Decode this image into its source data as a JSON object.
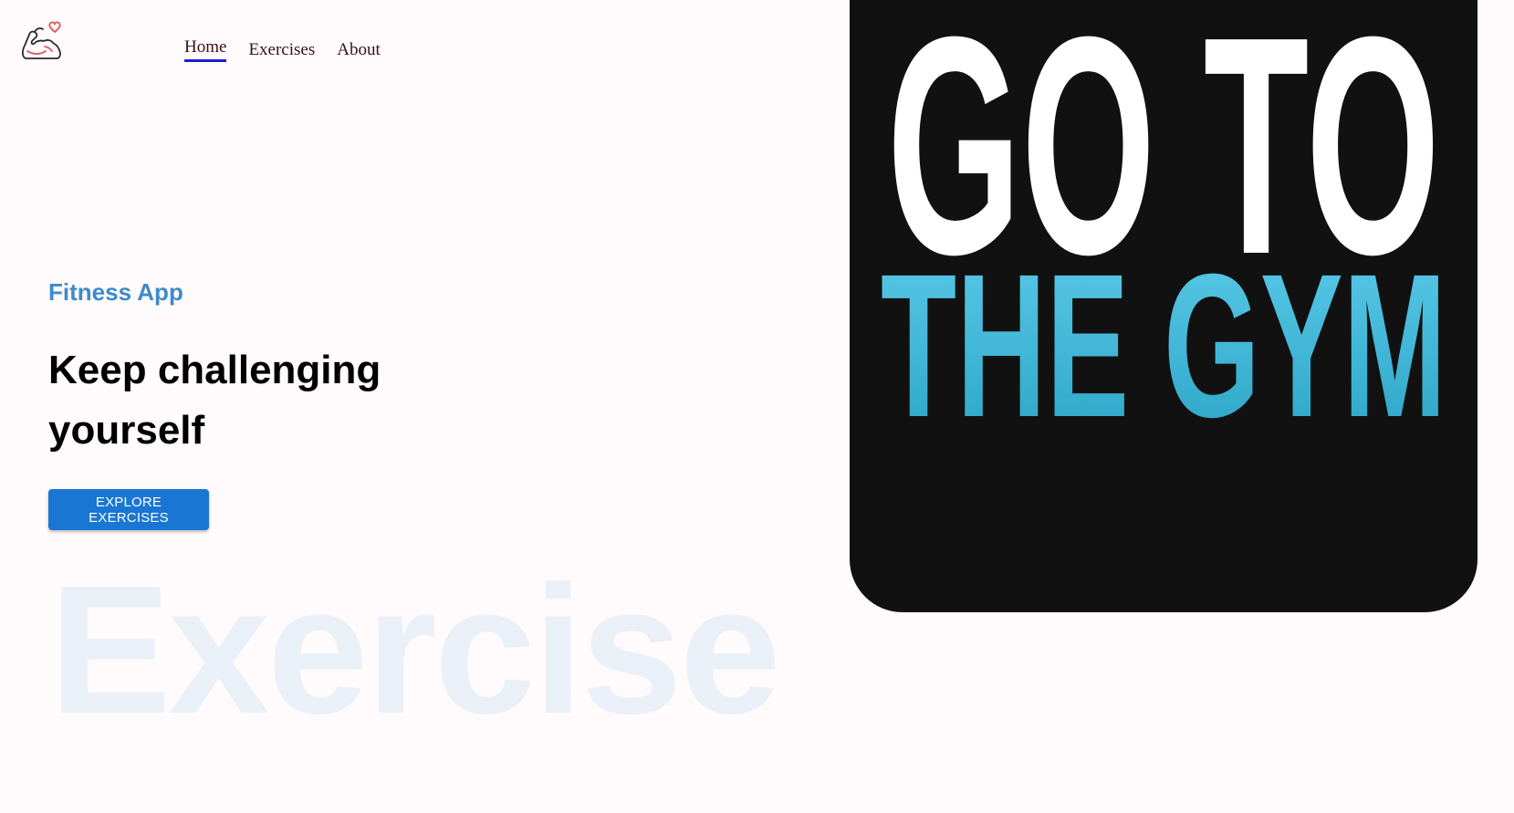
{
  "logo": {
    "icon": "flexed-arm-heart-icon"
  },
  "nav": {
    "items": [
      {
        "label": "Home",
        "active": true
      },
      {
        "label": "Exercises",
        "active": false
      },
      {
        "label": "About",
        "active": false
      }
    ]
  },
  "hero": {
    "kicker": "Fitness App",
    "headline": "Keep challenging yourself",
    "cta_label": "EXPLORE EXERCISES",
    "watermark": "Exercise"
  },
  "banner": {
    "line1": "GO TO",
    "line2": "THE GYM"
  },
  "colors": {
    "background": "#FFFAFB",
    "accent": "#1976D2",
    "kicker": "#3D8BCA",
    "banner_bg": "#111111",
    "gym_blue": "#3DB6D8",
    "watermark": "#EAF0F7",
    "nav_underline": "#1C1CD6"
  }
}
